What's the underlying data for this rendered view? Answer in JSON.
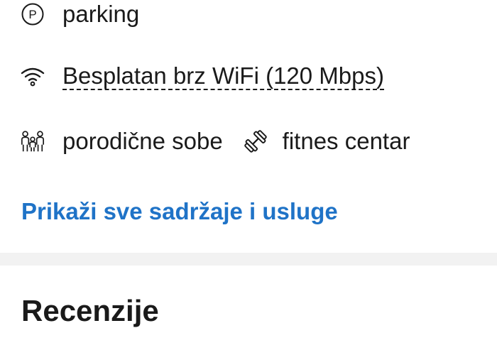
{
  "amenities": {
    "items": [
      {
        "icon": "parking-icon",
        "label": "parking"
      },
      {
        "icon": "wifi-icon",
        "label": "Besplatan brz WiFi (120 Mbps)"
      },
      {
        "icon": "family-icon",
        "label": "porodične sobe"
      },
      {
        "icon": "dumbbell-icon",
        "label": "fitnes centar"
      }
    ],
    "show_all_link": "Prikaži sve sadržaje i usluge"
  },
  "reviews": {
    "title": "Recenzije"
  },
  "colors": {
    "link": "#1f73c7",
    "text": "#1a1a1a",
    "divider": "#f2f2f2"
  }
}
